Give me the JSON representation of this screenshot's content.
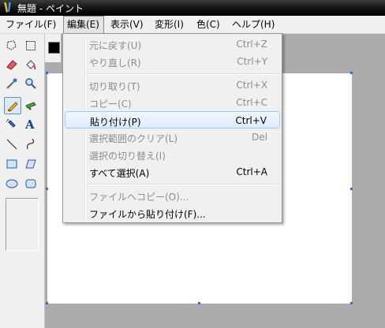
{
  "window": {
    "title": "無題 - ペイント"
  },
  "menubar": {
    "items": [
      {
        "label": "ファイル(F)"
      },
      {
        "label": "編集(E)"
      },
      {
        "label": "表示(V)"
      },
      {
        "label": "変形(I)"
      },
      {
        "label": "色(C)"
      },
      {
        "label": "ヘルプ(H)"
      }
    ]
  },
  "edit_menu": {
    "undo": {
      "label": "元に戻す(U)",
      "shortcut": "Ctrl+Z"
    },
    "redo": {
      "label": "やり直し(R)",
      "shortcut": "Ctrl+Y"
    },
    "cut": {
      "label": "切り取り(T)",
      "shortcut": "Ctrl+X"
    },
    "copy": {
      "label": "コピー(C)",
      "shortcut": "Ctrl+C"
    },
    "paste": {
      "label": "貼り付け(P)",
      "shortcut": "Ctrl+V"
    },
    "clear_selection": {
      "label": "選択範囲のクリア(L)",
      "shortcut": "Del"
    },
    "invert_selection": {
      "label": "選択の切り替え(I)"
    },
    "select_all": {
      "label": "すべて選択(A)",
      "shortcut": "Ctrl+A"
    },
    "copy_to": {
      "label": "ファイルへコピー(O)..."
    },
    "paste_from": {
      "label": "ファイルから貼り付け(F)..."
    }
  },
  "colors": {
    "foreground": "#000000",
    "selection_handle": "#2b6fd6",
    "menu_hover": "#dfeafa"
  },
  "toolbox": {
    "tools": [
      "free-select-icon",
      "rect-select-icon",
      "eraser-icon",
      "fill-icon",
      "color-picker-icon",
      "magnifier-icon",
      "pencil-icon",
      "brush-icon",
      "airbrush-icon",
      "text-icon",
      "line-icon",
      "curve-icon",
      "rectangle-icon",
      "polygon-icon",
      "ellipse-icon",
      "rounded-rect-icon"
    ],
    "selected": "pencil-icon"
  }
}
